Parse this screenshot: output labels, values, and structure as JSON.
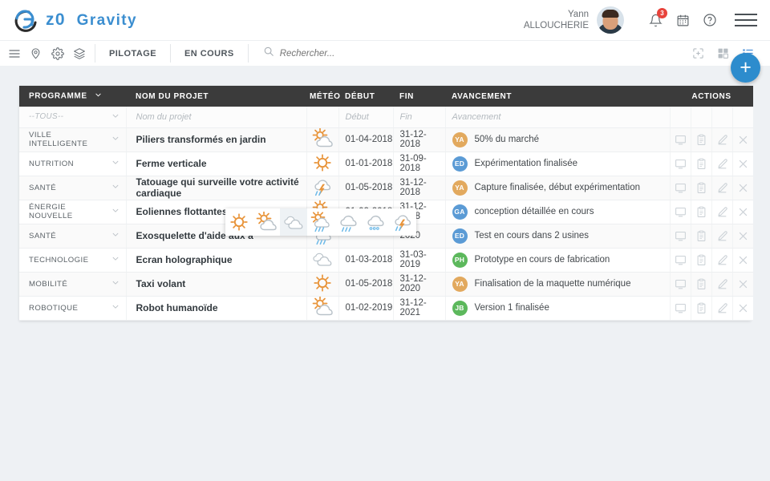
{
  "app": {
    "logo_text_1": "z0",
    "logo_text_2": "Gravity",
    "logo_icon": "gravity-g-logo"
  },
  "header": {
    "user_first_name": "Yann",
    "user_last_name": "ALLOUCHERIE",
    "avatar": "user-photo",
    "notifications_icon": "bell-icon",
    "notifications_count": "3",
    "calendar_icon": "calendar-icon",
    "help_icon": "question-mark-icon",
    "menu_icon": "hamburger-menu-icon"
  },
  "toolbar": {
    "icons": [
      {
        "name": "hamburger-menu-icon"
      },
      {
        "name": "location-pin-icon"
      },
      {
        "name": "gear-icon"
      },
      {
        "name": "layers-icon"
      }
    ],
    "nav_items": [
      {
        "label": "PILOTAGE"
      },
      {
        "label": "EN COURS"
      }
    ],
    "search": {
      "icon": "search-icon",
      "placeholder": "Rechercher...",
      "value": ""
    },
    "view_icons": [
      {
        "name": "fullscreen-icon",
        "active": false
      },
      {
        "name": "grid-view-icon",
        "active": false
      },
      {
        "name": "list-view-icon",
        "active": true
      }
    ],
    "add_button": {
      "name": "add-button",
      "label": "+",
      "color": "#2d8ccd"
    }
  },
  "table": {
    "columns": [
      {
        "key": "programme",
        "label": "PROGRAMME",
        "sortable": true,
        "sort_icon": "chevron-down-icon"
      },
      {
        "key": "nom",
        "label": "NOM DU PROJET"
      },
      {
        "key": "meteo",
        "label": "MÉTÉO"
      },
      {
        "key": "debut",
        "label": "DÉBUT"
      },
      {
        "key": "fin",
        "label": "FIN"
      },
      {
        "key": "avancement",
        "label": "AVANCEMENT"
      },
      {
        "key": "actions",
        "label": "ACTIONS"
      }
    ],
    "filter_row": {
      "programme": "--TOUS--",
      "nom_placeholder": "Nom du projet",
      "debut_placeholder": "Début",
      "fin_placeholder": "Fin",
      "avancement_placeholder": "Avancement"
    },
    "rows": [
      {
        "programme": "VILLE INTELLIGENTE",
        "nom": "Piliers transformés en jardin",
        "meteo": "sun-cloud-icon",
        "debut": "01-04-2018",
        "fin": "31-12-2018",
        "initials": "YA",
        "initials_color": "#e2a95e",
        "avancement": "50% du marché"
      },
      {
        "programme": "NUTRITION",
        "nom": "Ferme verticale",
        "meteo": "sun-icon",
        "debut": "01-01-2018",
        "fin": "31-09-2018",
        "initials": "ED",
        "initials_color": "#5b9bd5",
        "avancement": "Expérimentation finalisée"
      },
      {
        "programme": "SANTÉ",
        "nom": "Tatouage qui surveille votre activité cardiaque",
        "meteo": "storm-icon",
        "debut": "01-05-2018",
        "fin": "31-12-2018",
        "initials": "YA",
        "initials_color": "#e2a95e",
        "avancement": "Capture finalisée, début expérimentation"
      },
      {
        "programme": "ÉNERGIE NOUVELLE",
        "nom": "Eoliennes flottantes",
        "meteo": "sun-cloud-icon",
        "debut": "01-02-2018",
        "fin": "31-12-2018",
        "initials": "GA",
        "initials_color": "#5b9bd5",
        "avancement": "conception détaillée en cours"
      },
      {
        "programme": "SANTÉ",
        "nom": "Exosquelette d'aide aux a",
        "meteo": "sun-cloud-rain-icon",
        "debut": "",
        "fin": "2020",
        "initials": "ED",
        "initials_color": "#5b9bd5",
        "avancement": "Test en cours dans 2 usines"
      },
      {
        "programme": "TECHNOLOGIE",
        "nom": "Ecran holographique",
        "meteo": "cloudy-icon",
        "debut": "01-03-2018",
        "fin": "31-03-2019",
        "initials": "PH",
        "initials_color": "#5cb85c",
        "avancement": "Prototype en cours de fabrication"
      },
      {
        "programme": "MOBILITÉ",
        "nom": "Taxi volant",
        "meteo": "sun-icon",
        "debut": "01-05-2018",
        "fin": "31-12-2020",
        "initials": "YA",
        "initials_color": "#e2a95e",
        "avancement": "Finalisation de la maquette numérique"
      },
      {
        "programme": "ROBOTIQUE",
        "nom": "Robot humanoïde",
        "meteo": "sun-cloud-icon",
        "debut": "01-02-2019",
        "fin": "31-12-2021",
        "initials": "JB",
        "initials_color": "#5cb85c",
        "avancement": "Version 1 finalisée"
      }
    ],
    "row_action_icons": [
      {
        "name": "monitor-icon"
      },
      {
        "name": "clipboard-icon"
      },
      {
        "name": "edit-pencil-icon"
      },
      {
        "name": "close-x-icon"
      }
    ]
  },
  "weather_picker": {
    "visible": true,
    "selected_index": 2,
    "options": [
      {
        "name": "sun-icon"
      },
      {
        "name": "sun-cloud-icon"
      },
      {
        "name": "cloudy-icon"
      },
      {
        "name": "sun-cloud-rain-icon"
      },
      {
        "name": "rain-icon"
      },
      {
        "name": "snow-icon"
      },
      {
        "name": "storm-icon"
      }
    ]
  },
  "colors": {
    "brand_blue": "#3b8ed0",
    "header_dark": "#3b3b3b",
    "page_bg": "#eef1f4",
    "accent_orange": "#e8943a",
    "badge_red": "#e8433b"
  }
}
